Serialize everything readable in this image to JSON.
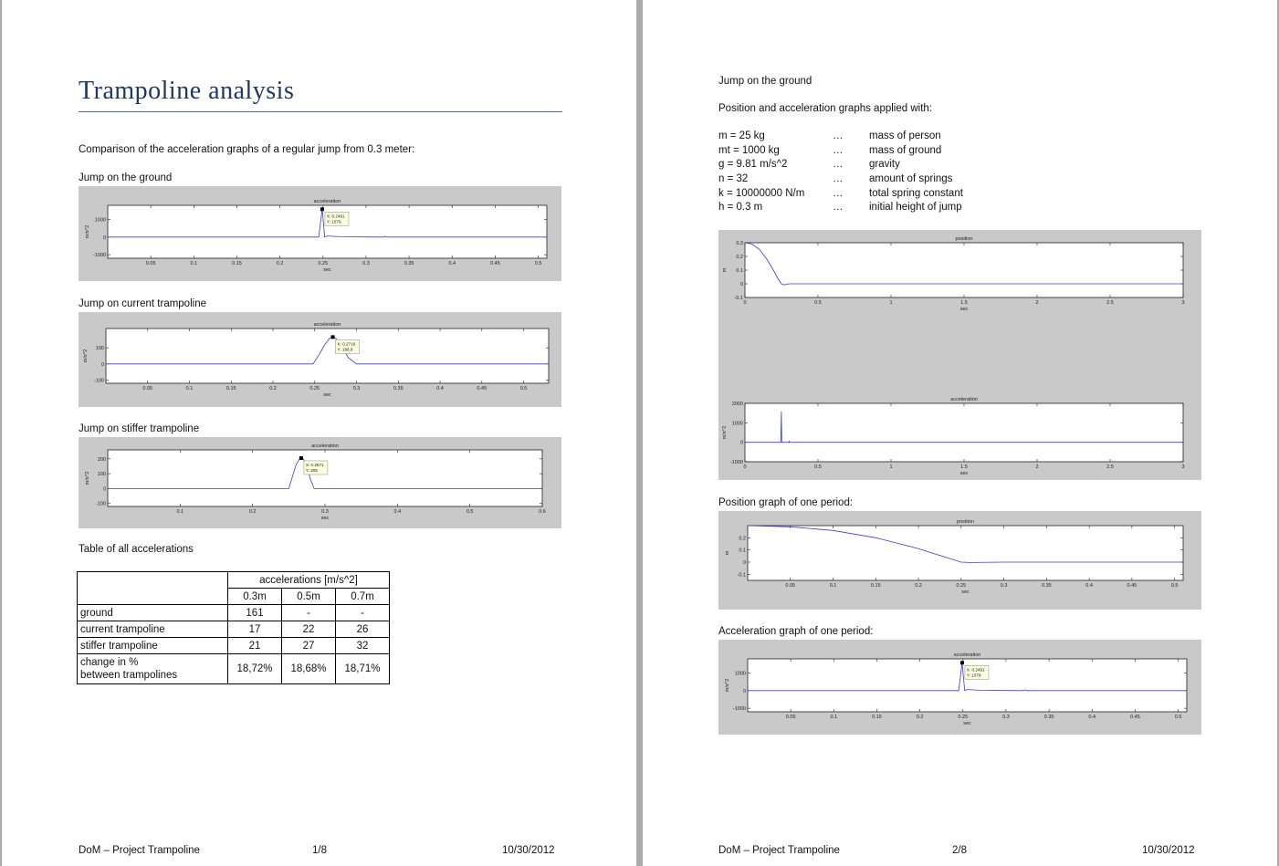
{
  "page1": {
    "title": "Trampoline analysis",
    "intro": "Comparison of the acceleration graphs of a regular jump from 0.3 meter:",
    "heading_ground": "Jump on the ground",
    "heading_current": "Jump on current trampoline",
    "heading_stiffer": "Jump on stiffer trampoline",
    "heading_table": "Table of all accelerations",
    "table": {
      "header": "accelerations [m/s^2]",
      "columns": [
        "0.3m",
        "0.5m",
        "0.7m"
      ],
      "rows": [
        {
          "label": "ground",
          "values": [
            "161",
            "-",
            "-"
          ]
        },
        {
          "label": "current trampoline",
          "values": [
            "17",
            "22",
            "26"
          ]
        },
        {
          "label": "stiffer trampoline",
          "values": [
            "21",
            "27",
            "32"
          ]
        }
      ],
      "change_label_1": "change in %",
      "change_label_2": "between trampolines",
      "change_values": [
        "18,72%",
        "18,68%",
        "18,71%"
      ]
    },
    "footer": {
      "left": "DoM – Project Trampoline",
      "center": "1/8",
      "right": "10/30/2012"
    }
  },
  "page2": {
    "heading_ground": "Jump on the ground",
    "params_intro": "Position and acceleration graphs applied with:",
    "params": [
      {
        "name": "m = 25 kg",
        "dots": "…",
        "desc": "mass of person"
      },
      {
        "name": "mt = 1000 kg",
        "dots": "…",
        "desc": "mass of ground"
      },
      {
        "name": "g = 9.81 m/s^2",
        "dots": "…",
        "desc": "gravity"
      },
      {
        "name": "n = 32",
        "dots": "…",
        "desc": "amount of springs"
      },
      {
        "name": "k = 10000000 N/m",
        "dots": "…",
        "desc": "total spring constant"
      },
      {
        "name": "h = 0.3 m",
        "dots": "…",
        "desc": "initial height of jump"
      }
    ],
    "heading_position_period": "Position graph of one period:",
    "heading_accel_period": "Acceleration graph of one period:",
    "footer": {
      "left": "DoM – Project Trampoline",
      "center": "2/8",
      "right": "10/30/2012"
    }
  },
  "chart_data": [
    {
      "id": "p1_ground",
      "type": "line",
      "title": "acceleration",
      "xlabel": "sec",
      "ylabel": "m/s^2",
      "xlim": [
        0,
        0.51
      ],
      "ylim": [
        -1200,
        1800
      ],
      "xticks": [
        0.05,
        0.1,
        0.15,
        0.2,
        0.25,
        0.3,
        0.35,
        0.4,
        0.45,
        0.5
      ],
      "xtick_labels": [
        "0.05",
        "0.1",
        "0.15",
        "0.2",
        "0.25",
        "0.3",
        "0.35",
        "0.4",
        "0.45",
        "0.5"
      ],
      "yticks": [
        1000,
        0,
        -1000
      ],
      "ytick_labels": [
        "1000",
        "0",
        "-1000"
      ],
      "x": [
        0,
        0.245,
        0.2491,
        0.252,
        0.255,
        0.27,
        0.3,
        0.32,
        0.322,
        0.324,
        0.35,
        0.4,
        0.5,
        0.51
      ],
      "y": [
        0,
        0,
        1579,
        0,
        60,
        20,
        5,
        0,
        40,
        0,
        0,
        0,
        0,
        0
      ],
      "datatip": {
        "x": 0.2491,
        "y": 1579,
        "label_x": "X: 0.2491",
        "label_y": "Y: 1579"
      }
    },
    {
      "id": "p1_current",
      "type": "line",
      "title": "acceleration",
      "xlabel": "sec",
      "ylabel": "m/s^2",
      "xlim": [
        0,
        0.53
      ],
      "ylim": [
        -120,
        220
      ],
      "xticks": [
        0.05,
        0.1,
        0.15,
        0.2,
        0.25,
        0.3,
        0.35,
        0.4,
        0.45,
        0.5
      ],
      "xtick_labels": [
        "0.05",
        "0.1",
        "0.15",
        "0.2",
        "0.25",
        "0.3",
        "0.35",
        "0.4",
        "0.45",
        "0.5"
      ],
      "yticks": [
        100,
        0,
        -100
      ],
      "ytick_labels": [
        "100",
        "0",
        "-100"
      ],
      "x": [
        0,
        0.248,
        0.255,
        0.262,
        0.268,
        0.2716,
        0.275,
        0.282,
        0.29,
        0.3,
        0.53
      ],
      "y": [
        0,
        0,
        55,
        120,
        160,
        166.9,
        160,
        110,
        40,
        0,
        0
      ],
      "datatip": {
        "x": 0.2716,
        "y": 166.9,
        "label_x": "X: 0.2716",
        "label_y": "Y: 166.9"
      }
    },
    {
      "id": "p1_stiffer",
      "type": "line",
      "title": "acceleration",
      "xlabel": "sec",
      "ylabel": "m/s^2",
      "xlim": [
        0,
        0.6
      ],
      "ylim": [
        -120,
        260
      ],
      "xticks": [
        0.1,
        0.2,
        0.3,
        0.4,
        0.5,
        0.6
      ],
      "xtick_labels": [
        "0.1",
        "0.2",
        "0.3",
        "0.4",
        "0.5",
        "0.6"
      ],
      "yticks": [
        200,
        100,
        0,
        -100
      ],
      "ytick_labels": [
        "200",
        "100",
        "0",
        "-100"
      ],
      "x": [
        0,
        0.25,
        0.255,
        0.26,
        0.265,
        0.2671,
        0.27,
        0.275,
        0.28,
        0.285,
        0.6
      ],
      "y": [
        0,
        0,
        80,
        160,
        200,
        205,
        200,
        150,
        60,
        0,
        0
      ],
      "datatip": {
        "x": 0.2671,
        "y": 205,
        "label_x": "X: 0.2671",
        "label_y": "Y: 205"
      }
    },
    {
      "id": "p2_position",
      "type": "line",
      "title": "position",
      "xlabel": "sec",
      "ylabel": "m",
      "xlim": [
        0,
        3
      ],
      "ylim": [
        -0.1,
        0.3
      ],
      "xticks": [
        0,
        0.5,
        1,
        1.5,
        2,
        2.5,
        3
      ],
      "xtick_labels": [
        "0",
        "0.5",
        "1",
        "1.5",
        "2",
        "2.5",
        "3"
      ],
      "yticks": [
        0.3,
        0.2,
        0.1,
        0,
        -0.1
      ],
      "ytick_labels": [
        "0.3",
        "0.2",
        "0.1",
        "0",
        "-0.1"
      ],
      "x": [
        0,
        0.05,
        0.1,
        0.15,
        0.2,
        0.23,
        0.25,
        0.27,
        0.3,
        3
      ],
      "y": [
        0.3,
        0.29,
        0.25,
        0.18,
        0.09,
        0.03,
        0,
        -0.008,
        0,
        0
      ]
    },
    {
      "id": "p2_accel",
      "type": "line",
      "title": "acceleration",
      "xlabel": "sec",
      "ylabel": "m/s^2",
      "xlim": [
        0,
        3
      ],
      "ylim": [
        -1000,
        2000
      ],
      "xticks": [
        0,
        0.5,
        1,
        1.5,
        2,
        2.5,
        3
      ],
      "xtick_labels": [
        "0",
        "0.5",
        "1",
        "1.5",
        "2",
        "2.5",
        "3"
      ],
      "yticks": [
        2000,
        1000,
        0,
        -1000
      ],
      "ytick_labels": [
        "2000",
        "1000",
        "0",
        "-1000"
      ],
      "x": [
        0,
        0.245,
        0.2491,
        0.252,
        0.3,
        0.302,
        0.304,
        3
      ],
      "y": [
        0,
        0,
        1579,
        0,
        0,
        80,
        0,
        0
      ]
    },
    {
      "id": "p2_position_period",
      "type": "line",
      "title": "position",
      "xlabel": "sec",
      "ylabel": "m",
      "xlim": [
        0,
        0.51
      ],
      "ylim": [
        -0.15,
        0.3
      ],
      "xticks": [
        0.05,
        0.1,
        0.15,
        0.2,
        0.25,
        0.3,
        0.35,
        0.4,
        0.45,
        0.5
      ],
      "xtick_labels": [
        "0.05",
        "0.1",
        "0.15",
        "0.2",
        "0.25",
        "0.3",
        "0.35",
        "0.4",
        "0.45",
        "0.5"
      ],
      "yticks": [
        0.2,
        0.1,
        0,
        -0.1
      ],
      "ytick_labels": [
        "0.2",
        "0.1",
        "0",
        "-0.1"
      ],
      "x": [
        0,
        0.05,
        0.1,
        0.15,
        0.2,
        0.25,
        0.26,
        0.3,
        0.51
      ],
      "y": [
        0.3,
        0.29,
        0.26,
        0.2,
        0.11,
        0,
        -0.003,
        0,
        0
      ]
    },
    {
      "id": "p2_accel_period",
      "type": "line",
      "title": "acceleration",
      "xlabel": "sec",
      "ylabel": "m/s^2",
      "xlim": [
        0,
        0.51
      ],
      "ylim": [
        -1200,
        1800
      ],
      "xticks": [
        0.05,
        0.1,
        0.15,
        0.2,
        0.25,
        0.3,
        0.35,
        0.4,
        0.45,
        0.5
      ],
      "xtick_labels": [
        "0.05",
        "0.1",
        "0.15",
        "0.2",
        "0.25",
        "0.3",
        "0.35",
        "0.4",
        "0.45",
        "0.5"
      ],
      "yticks": [
        1000,
        0,
        -1000
      ],
      "ytick_labels": [
        "1000",
        "0",
        "-1000"
      ],
      "x": [
        0,
        0.245,
        0.2491,
        0.252,
        0.255,
        0.27,
        0.3,
        0.32,
        0.322,
        0.324,
        0.35,
        0.4,
        0.5,
        0.51
      ],
      "y": [
        0,
        0,
        1579,
        0,
        60,
        20,
        5,
        0,
        40,
        0,
        0,
        0,
        0,
        0
      ],
      "datatip": {
        "x": 0.2491,
        "y": 1579,
        "label_x": "X: 0.2491",
        "label_y": "Y: 1579"
      }
    }
  ]
}
